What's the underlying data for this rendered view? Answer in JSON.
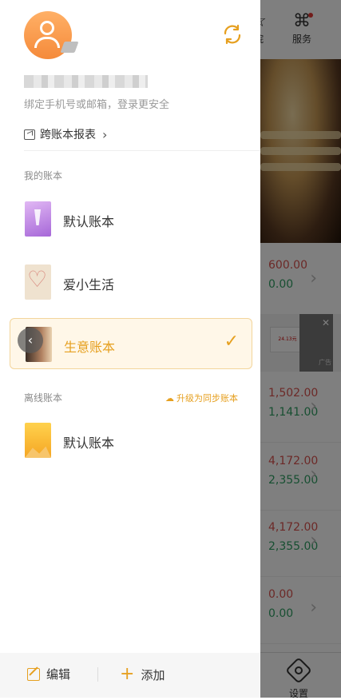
{
  "header": {
    "bind_tip": "绑定手机号或邮箱，登录更安全",
    "cross_report": "跨账本报表"
  },
  "sections": {
    "my_books": "我的账本",
    "offline_books": "离线账本",
    "upgrade_link": "升级为同步账本"
  },
  "my_books": [
    {
      "name": "默认账本"
    },
    {
      "name": "爱小生活"
    },
    {
      "name": "生意账本",
      "selected": true
    }
  ],
  "offline_books": [
    {
      "name": "默认账本"
    }
  ],
  "bottom": {
    "edit": "编辑",
    "add": "添加"
  },
  "background": {
    "nav_partial": "院",
    "nav_service": "服务",
    "rows": [
      {
        "v1": "600.00",
        "v2": "0.00"
      },
      {
        "v1": "1,502.00",
        "v2": "1,141.00"
      },
      {
        "v1": "4,172.00",
        "v2": "2,355.00"
      },
      {
        "v1": "4,172.00",
        "v2": "2,355.00"
      },
      {
        "v1": "0.00",
        "v2": "0.00"
      }
    ],
    "ad_tag": "广告",
    "ad_thumb_text": "24.13元",
    "settings": "设置"
  },
  "colors": {
    "accent": "#e6a020",
    "income": "#d9534f",
    "expense": "#2e9e63"
  }
}
